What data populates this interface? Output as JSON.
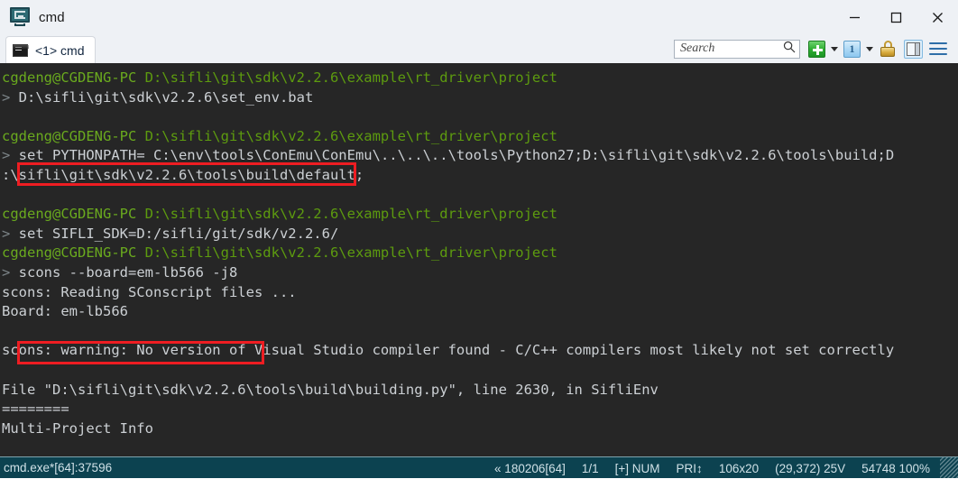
{
  "window": {
    "title": "cmd",
    "app_icon": "conemu-monitor-icon",
    "controls": {
      "minimize": "minimize-icon",
      "maximize": "maximize-icon",
      "close": "close-icon"
    }
  },
  "tabbar": {
    "tabs": [
      {
        "label": "<1> cmd",
        "icon": "console-icon",
        "active": true
      }
    ],
    "search": {
      "placeholder": "Search",
      "value": "",
      "icon": "search-icon"
    },
    "buttons": [
      {
        "name": "new-console-button",
        "icon": "green-plus-icon"
      },
      {
        "name": "new-console-dropdown",
        "icon": "chevron-down-icon"
      },
      {
        "name": "active-console-button",
        "icon": "blue-one-icon",
        "label": "1"
      },
      {
        "name": "active-console-dropdown",
        "icon": "chevron-down-icon"
      },
      {
        "name": "admin-lock-button",
        "icon": "lock-icon"
      },
      {
        "name": "split-pane-button",
        "icon": "split-pane-icon"
      },
      {
        "name": "main-menu-button",
        "icon": "hamburger-menu-icon"
      }
    ]
  },
  "terminal": {
    "background": "#262626",
    "foreground": "#ccd0d4",
    "prompt_color": "#6aaa1e",
    "annotation_color": "#ee1d22",
    "lines": [
      {
        "type": "prompt",
        "user": "cgdeng@CGDENG-PC",
        "path": "D:\\sifli\\git\\sdk\\v2.2.6\\example\\rt_driver\\project"
      },
      {
        "type": "command",
        "marker": ">",
        "text": " D:\\sifli\\git\\sdk\\v2.2.6\\set_env.bat",
        "highlighted": true
      },
      {
        "type": "blank"
      },
      {
        "type": "prompt",
        "user": "cgdeng@CGDENG-PC",
        "path": "D:\\sifli\\git\\sdk\\v2.2.6\\example\\rt_driver\\project"
      },
      {
        "type": "command",
        "marker": ">",
        "text": " set PYTHONPATH= C:\\env\\tools\\ConEmu\\ConEmu\\..\\..\\..\\tools\\Python27;D:\\sifli\\git\\sdk\\v2.2.6\\tools\\build;D"
      },
      {
        "type": "output",
        "text": ":\\sifli\\git\\sdk\\v2.2.6\\tools\\build\\default;"
      },
      {
        "type": "blank"
      },
      {
        "type": "prompt",
        "user": "cgdeng@CGDENG-PC",
        "path": "D:\\sifli\\git\\sdk\\v2.2.6\\example\\rt_driver\\project"
      },
      {
        "type": "command",
        "marker": ">",
        "text": " set SIFLI_SDK=D:/sifli/git/sdk/v2.2.6/"
      },
      {
        "type": "prompt",
        "user": "cgdeng@CGDENG-PC",
        "path": "D:\\sifli\\git\\sdk\\v2.2.6\\example\\rt_driver\\project"
      },
      {
        "type": "command",
        "marker": ">",
        "text": " scons --board=em-lb566 -j8",
        "highlighted": true
      },
      {
        "type": "output",
        "text": "scons: Reading SConscript files ..."
      },
      {
        "type": "output",
        "text": "Board: em-lb566"
      },
      {
        "type": "blank"
      },
      {
        "type": "output",
        "text": "scons: warning: No version of Visual Studio compiler found - C/C++ compilers most likely not set correctly"
      },
      {
        "type": "blank"
      },
      {
        "type": "output",
        "text": "File \"D:\\sifli\\git\\sdk\\v2.2.6\\tools\\build\\building.py\", line 2630, in SifliEnv"
      },
      {
        "type": "output",
        "text": "========"
      },
      {
        "type": "output",
        "text": "Multi-Project Info"
      }
    ]
  },
  "statusbar": {
    "left": "cmd.exe*[64]:37596",
    "cells": [
      "« 180206[64]",
      "1/1",
      "[+] NUM",
      "PRI↕",
      "106x20",
      "(29,372) 25V",
      "54748 100%"
    ]
  }
}
